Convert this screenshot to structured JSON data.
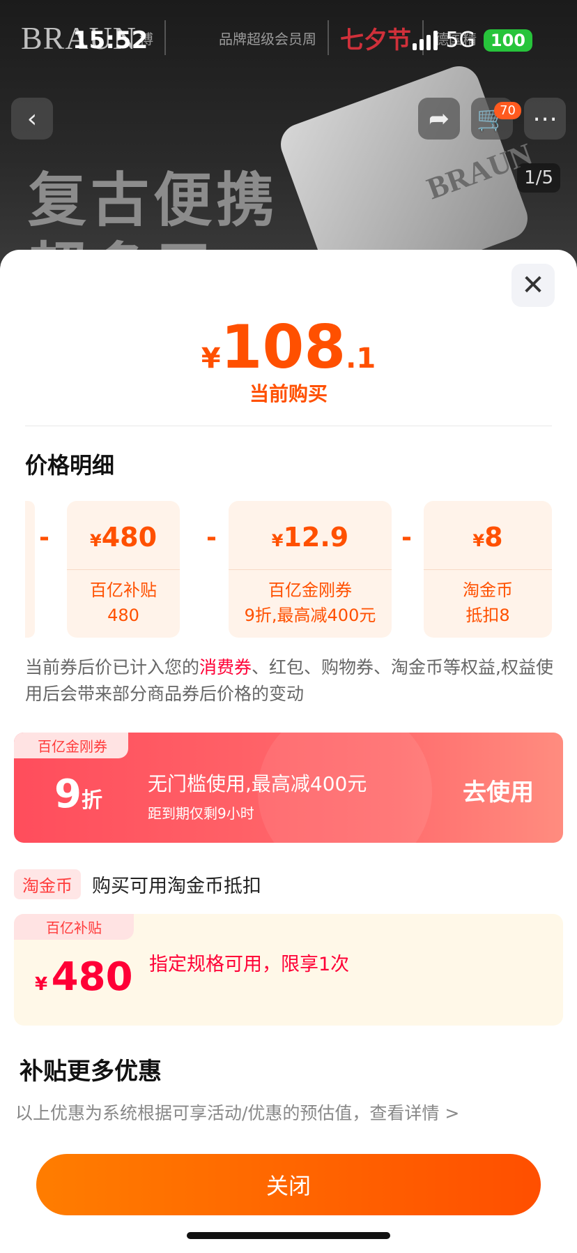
{
  "status": {
    "time": "15:52",
    "network": "5G",
    "battery": "100"
  },
  "hero": {
    "brand": "BRAUN",
    "brand_suffix": "博",
    "campaign": "品牌超级会员周",
    "festival": "七夕节",
    "origin": "德国精",
    "title_line1": "复古便携",
    "title_line2": "超多用",
    "product_brand": "BRAUN",
    "cart_count": "70",
    "page_indicator": "1/5"
  },
  "sheet": {
    "price": {
      "currency": "¥",
      "integer": "108",
      "decimal": ".1"
    },
    "price_caption": "当前购买",
    "section_title": "价格明细",
    "breakdown": [
      {
        "amount": "480",
        "label": "百亿补贴",
        "sub": "480"
      },
      {
        "amount": "12.9",
        "label": "百亿金刚券",
        "sub": "9折,最高减400元"
      },
      {
        "amount": "8",
        "label": "淘金币",
        "sub": "抵扣8"
      }
    ],
    "minus": "-",
    "currency": "¥",
    "note_part1": "当前券后价已计入您的",
    "note_highlight": "消费券",
    "note_part2": "、红包、购物券、淘金币等权益,权益使用后会带来部分商品券后价格的变动",
    "coupon": {
      "tag": "百亿金刚券",
      "discount_num": "9",
      "discount_unit": "折",
      "desc": "无门槛使用,最高减400元",
      "expiry": "距到期仅剩9小时",
      "action": "去使用"
    },
    "coin": {
      "tag": "淘金币",
      "text": "购买可用淘金币抵扣"
    },
    "subsidy": {
      "tag": "百亿补贴",
      "amount": "480",
      "desc": "指定规格可用，限享1次"
    },
    "more_title": "补贴更多优惠",
    "more_note": "以上优惠为系统根据可享活动/优惠的预估值，查看详情 >",
    "close_label": "关闭"
  },
  "colors": {
    "accent": "#ff5000",
    "coupon": "#ff4d5c",
    "subsidy": "#ff0036"
  }
}
